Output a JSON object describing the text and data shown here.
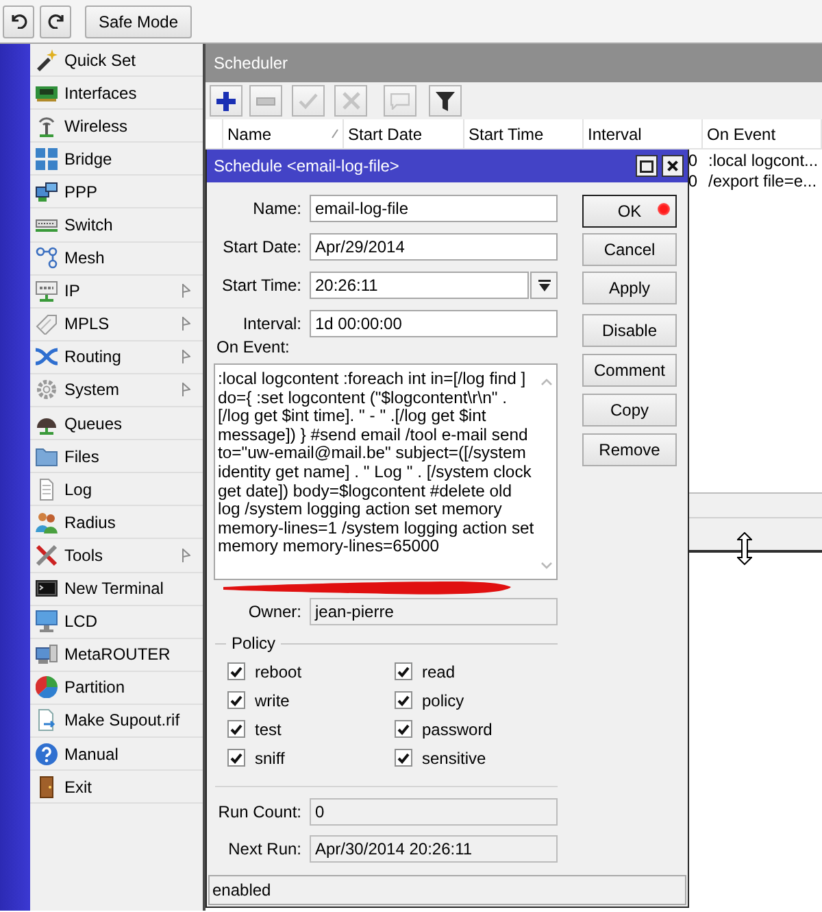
{
  "toolbar": {
    "safe_mode": {
      "label": "Safe Mode"
    }
  },
  "sidebar": {
    "items": [
      {
        "label": "Quick Set",
        "submenu": false
      },
      {
        "label": "Interfaces",
        "submenu": false
      },
      {
        "label": "Wireless",
        "submenu": false
      },
      {
        "label": "Bridge",
        "submenu": false
      },
      {
        "label": "PPP",
        "submenu": false
      },
      {
        "label": "Switch",
        "submenu": false
      },
      {
        "label": "Mesh",
        "submenu": false
      },
      {
        "label": "IP",
        "submenu": true
      },
      {
        "label": "MPLS",
        "submenu": true
      },
      {
        "label": "Routing",
        "submenu": true
      },
      {
        "label": "System",
        "submenu": true
      },
      {
        "label": "Queues",
        "submenu": false
      },
      {
        "label": "Files",
        "submenu": false
      },
      {
        "label": "Log",
        "submenu": false
      },
      {
        "label": "Radius",
        "submenu": false
      },
      {
        "label": "Tools",
        "submenu": true
      },
      {
        "label": "New Terminal",
        "submenu": false
      },
      {
        "label": "LCD",
        "submenu": false
      },
      {
        "label": "MetaROUTER",
        "submenu": false
      },
      {
        "label": "Partition",
        "submenu": false
      },
      {
        "label": "Make Supout.rif",
        "submenu": false
      },
      {
        "label": "Manual",
        "submenu": false
      },
      {
        "label": "Exit",
        "submenu": false
      }
    ]
  },
  "scheduler": {
    "title": "Scheduler",
    "toolbar": [
      {
        "kind": "add",
        "disabled": false
      },
      {
        "kind": "remove",
        "disabled": true
      },
      {
        "kind": "enable",
        "disabled": true
      },
      {
        "kind": "disable",
        "disabled": true
      },
      {
        "kind": "comment",
        "disabled": true
      },
      {
        "kind": "filter",
        "disabled": false
      }
    ],
    "table": {
      "columns": [
        {
          "label": "Name",
          "sorted": true
        },
        {
          "label": "Start Date",
          "sorted": false
        },
        {
          "label": "Start Time",
          "sorted": false
        },
        {
          "label": "Interval",
          "sorted": false
        },
        {
          "label": "On Event",
          "sorted": false
        }
      ],
      "rows": [
        {
          "interval": "0",
          "on_event": ":local logcont..."
        },
        {
          "interval": "0",
          "on_event": "/export file=e..."
        }
      ]
    }
  },
  "dialog": {
    "title": "Schedule <email-log-file>",
    "fields": [
      {
        "label": "Name:",
        "value": "email-log-file",
        "kind": "text"
      },
      {
        "label": "Start Date:",
        "value": "Apr/29/2014",
        "kind": "text"
      },
      {
        "label": "Start Time:",
        "value": "20:26:11",
        "kind": "dropdown"
      },
      {
        "label": "Interval:",
        "value": "1d 00:00:00",
        "kind": "text"
      }
    ],
    "on_event": {
      "label": "On Event:",
      "value": ":local logcontent :foreach int in=[/log find ] do={ :set logcontent (\"$logcontent\\r\\n\" . [/log get $int time]. \" - \" .[/log get $int message]) } #send email /tool e-mail send to=\"uw-email@mail.be\" subject=([/system identity get name] . \" Log \" . [/system clock get date]) body=$logcontent #delete old log /system logging action set memory memory-lines=1 /system logging action set memory memory-lines=65000"
    },
    "owner": {
      "label": "Owner:",
      "value": "jean-pierre",
      "kind": "readonly"
    },
    "policy": {
      "title": "Policy",
      "options": [
        {
          "label": "reboot",
          "checked": true
        },
        {
          "label": "read",
          "checked": true
        },
        {
          "label": "write",
          "checked": true
        },
        {
          "label": "policy",
          "checked": true
        },
        {
          "label": "test",
          "checked": true
        },
        {
          "label": "password",
          "checked": true
        },
        {
          "label": "sniff",
          "checked": true
        },
        {
          "label": "sensitive",
          "checked": true
        }
      ]
    },
    "stats": [
      {
        "label": "Run Count:",
        "value": "0",
        "kind": "readonly"
      },
      {
        "label": "Next Run:",
        "value": "Apr/30/2014 20:26:11",
        "kind": "readonly"
      }
    ],
    "button_groups": [
      [
        {
          "label": "OK",
          "default": true
        },
        {
          "label": "Cancel",
          "default": false
        },
        {
          "label": "Apply",
          "default": false
        }
      ],
      [
        {
          "label": "Disable",
          "default": false
        },
        {
          "label": "Comment",
          "default": false
        },
        {
          "label": "Copy",
          "default": false
        },
        {
          "label": "Remove",
          "default": false
        }
      ]
    ],
    "status": "enabled"
  }
}
